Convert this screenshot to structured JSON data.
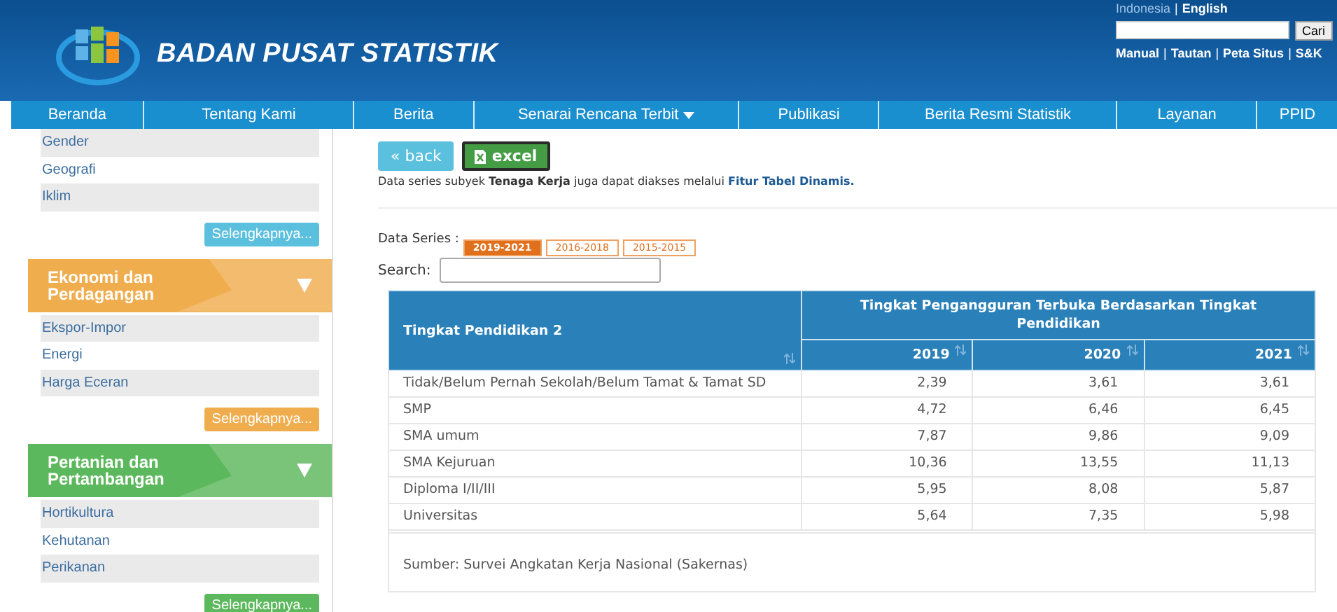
{
  "header": {
    "site_title": "BADAN PUSAT STATISTIK",
    "languages": [
      {
        "label": "Indonesia",
        "selected": false
      },
      {
        "label": "English",
        "selected": true
      }
    ],
    "separator": "|",
    "search_button": "Cari",
    "links": [
      "Manual",
      "Tautan",
      "Peta Situs",
      "S&K"
    ]
  },
  "nav": [
    {
      "label": "Beranda",
      "dropdown": false
    },
    {
      "label": "Tentang Kami",
      "dropdown": false
    },
    {
      "label": "Berita",
      "dropdown": false
    },
    {
      "label": "Senarai Rencana Terbit",
      "dropdown": true
    },
    {
      "label": "Publikasi",
      "dropdown": false
    },
    {
      "label": "Berita Resmi Statistik",
      "dropdown": false
    },
    {
      "label": "Layanan",
      "dropdown": false
    },
    {
      "label": "PPID",
      "dropdown": false
    }
  ],
  "sidebar": {
    "groups": [
      {
        "color": "#5bc0de",
        "items": [
          "Gender",
          "Geografi",
          "Iklim"
        ],
        "more": "Selengkapnya..."
      },
      {
        "title": "Ekonomi dan Perdagangan",
        "color": "#f0ad4e",
        "items": [
          "Ekspor-Impor",
          "Energi",
          "Harga Eceran"
        ],
        "more": "Selengkapnya..."
      },
      {
        "title": "Pertanian dan Pertambangan",
        "color": "#5cb85c",
        "items": [
          "Hortikultura",
          "Kehutanan",
          "Perikanan"
        ],
        "more": "Selengkapnya..."
      }
    ]
  },
  "content": {
    "back_button": "« back",
    "excel_button": "excel",
    "info_text": "Data series subyek **Tenaga Kerja** juga dapat diakses melalui",
    "info_link": "Fitur Tabel Dinamis.",
    "series_label": "Data Series :",
    "series_tabs": [
      {
        "label": "2019-2021",
        "selected": true
      },
      {
        "label": "2016-2018",
        "selected": false
      },
      {
        "label": "2015-2015",
        "selected": false
      }
    ],
    "search_label": "Search:",
    "table": {
      "row_header": "Tingkat Pendidikan 2",
      "group_header": "Tingkat Pengangguran Terbuka Berdasarkan Tingkat Pendidikan",
      "columns": [
        "2019",
        "2020",
        "2021"
      ],
      "rows": [
        {
          "label": "Tidak/Belum Pernah Sekolah/Belum Tamat & Tamat SD",
          "values": [
            "2,39",
            "3,61",
            "3,61"
          ]
        },
        {
          "label": "SMP",
          "values": [
            "4,72",
            "6,46",
            "6,45"
          ]
        },
        {
          "label": "SMA umum",
          "values": [
            "7,87",
            "9,86",
            "9,09"
          ]
        },
        {
          "label": "SMA Kejuruan",
          "values": [
            "10,36",
            "13,55",
            "11,13"
          ]
        },
        {
          "label": "Diploma I/II/III",
          "values": [
            "5,95",
            "8,08",
            "5,87"
          ]
        },
        {
          "label": "Universitas",
          "values": [
            "5,64",
            "7,35",
            "5,98"
          ]
        }
      ],
      "source": "Sumber: Survei Angkatan Kerja Nasional (Sakernas)"
    }
  }
}
